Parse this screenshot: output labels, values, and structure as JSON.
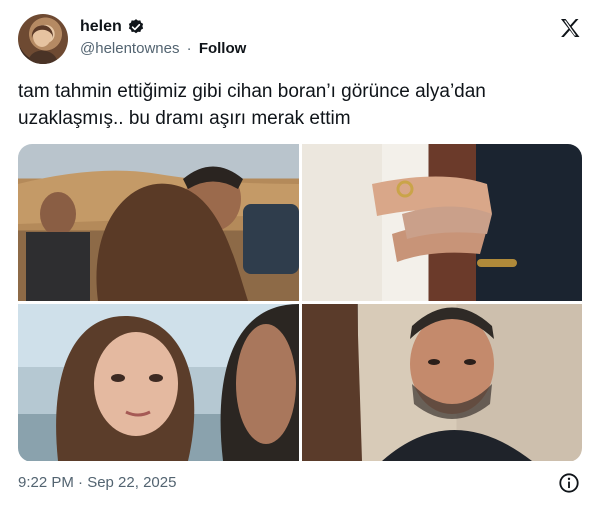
{
  "author": {
    "display_name": "helen",
    "handle": "@helentownes",
    "separator": "·",
    "follow_label": "Follow"
  },
  "tweet": {
    "text": "tam tahmin ettiğimiz gibi cihan boran’ı görünce alya’dan uzaklaşmış.. bu dramı aşırı merak ettim",
    "timestamp": "9:22 PM · Sep 22, 2025"
  },
  "media": {
    "count": 4,
    "photos": [
      "photo-hug",
      "photo-hands-ring",
      "photo-woman-tearful",
      "photo-man-sad"
    ]
  },
  "icons": {
    "verified": "verified-badge-icon",
    "brand": "x-logo-icon",
    "info": "info-icon"
  },
  "colors": {
    "text": "#0f1419",
    "secondary": "#536471",
    "background": "#ffffff"
  }
}
